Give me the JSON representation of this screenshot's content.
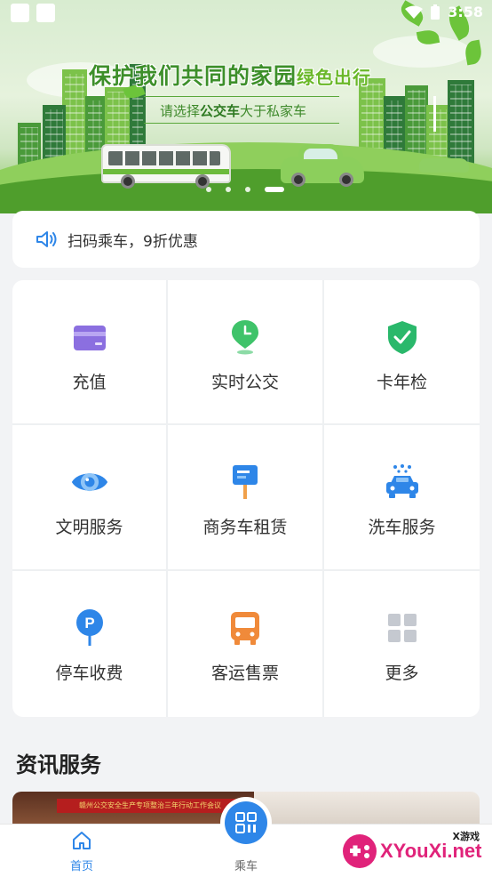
{
  "status_bar": {
    "time": "3:58"
  },
  "banner": {
    "title_main": "保护我们共同的家园",
    "title_accent": "绿色出行",
    "subtitle_pre": "请选择",
    "subtitle_bold": "公交车",
    "subtitle_post": "大于私家车",
    "carousel_count": 4,
    "carousel_active": 3
  },
  "notice": {
    "text": "扫码乘车，9折优惠"
  },
  "services": [
    {
      "label": "充值",
      "icon": "wallet-card-icon"
    },
    {
      "label": "实时公交",
      "icon": "location-clock-icon"
    },
    {
      "label": "卡年检",
      "icon": "shield-check-icon"
    },
    {
      "label": "文明服务",
      "icon": "eye-icon"
    },
    {
      "label": "商务车租赁",
      "icon": "signboard-icon"
    },
    {
      "label": "洗车服务",
      "icon": "car-wash-icon"
    },
    {
      "label": "停车收费",
      "icon": "parking-pin-icon"
    },
    {
      "label": "客运售票",
      "icon": "bus-icon"
    },
    {
      "label": "更多",
      "icon": "grid-more-icon"
    }
  ],
  "news": {
    "title": "资讯服务",
    "image1_text": "赣州公交安全生产专项整治三年行动工作会议"
  },
  "bottom_nav": {
    "home_label": "首页",
    "ride_label": "乘车"
  },
  "watermark": {
    "top": "X游戏",
    "main": "XYouXi.net"
  },
  "colors": {
    "primary": "#2e86e8",
    "green": "#4caf50",
    "purple": "#8b6fe0",
    "orange": "#f08a3a",
    "grey": "#c5c9d0"
  }
}
